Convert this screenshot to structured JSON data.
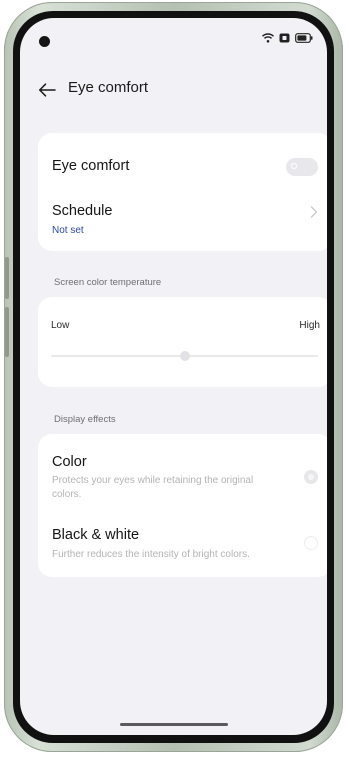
{
  "header": {
    "title": "Eye comfort",
    "back_icon": "arrow-left-icon"
  },
  "eye_comfort": {
    "label": "Eye comfort",
    "enabled": false
  },
  "schedule": {
    "label": "Schedule",
    "value": "Not set"
  },
  "color_temperature": {
    "section_label": "Screen color temperature",
    "low_label": "Low",
    "high_label": "High",
    "level": 0.5
  },
  "display_effects": {
    "section_label": "Display effects",
    "options": [
      {
        "title": "Color",
        "description": "Protects your eyes while retaining the original colors.",
        "selected": true
      },
      {
        "title": "Black & white",
        "description": "Further reduces the intensity of bright colors.",
        "selected": false
      }
    ]
  },
  "colors": {
    "background": "#f2f1f5",
    "card": "#ffffff",
    "link": "#2a48a8"
  }
}
